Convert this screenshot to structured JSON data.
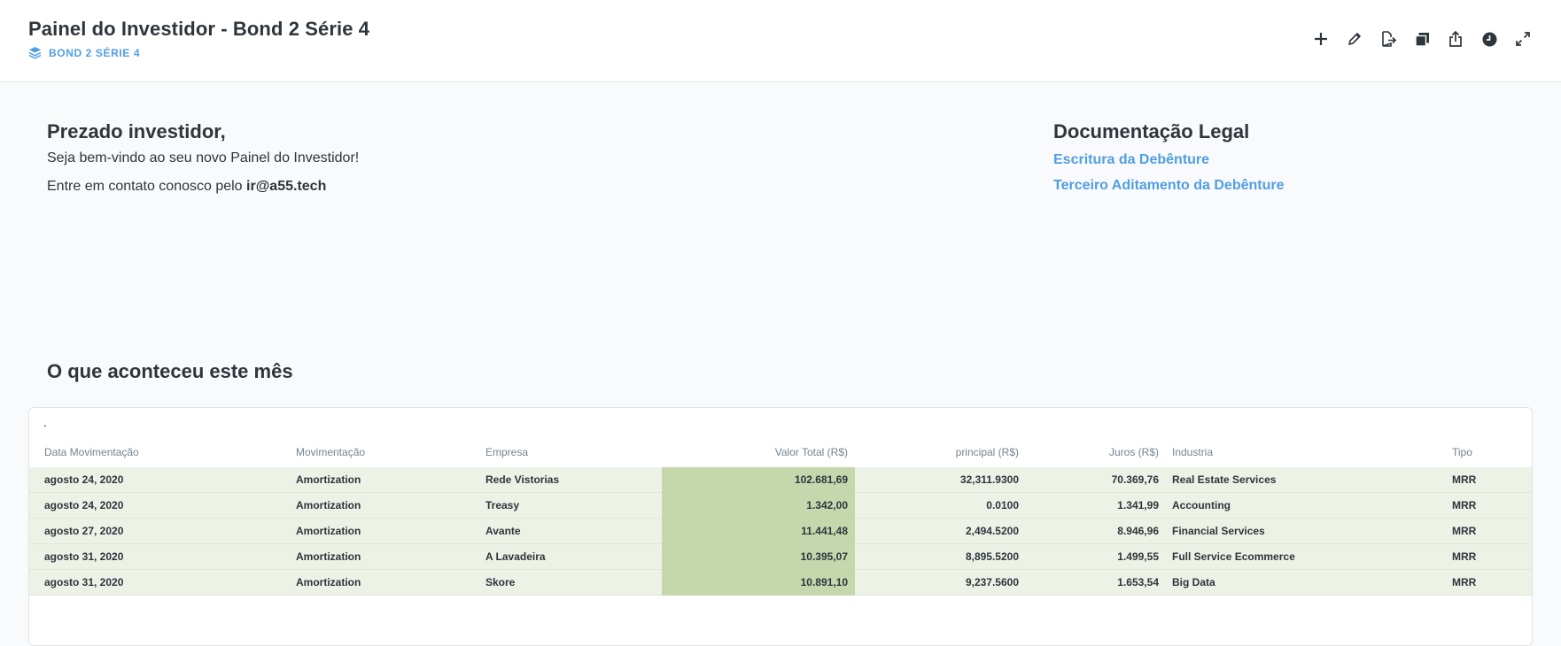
{
  "header": {
    "title": "Painel do Investidor - Bond 2 Série 4",
    "collection": "BOND 2 SÉRIE 4",
    "tools": [
      "add-icon",
      "pencil-icon",
      "move-icon",
      "duplicate-icon",
      "share-icon",
      "history-icon",
      "fullscreen-icon"
    ]
  },
  "welcome": {
    "heading": "Prezado investidor,",
    "line1": "Seja bem-vindo ao seu novo Painel do Investidor!",
    "line2_prefix": "Entre em contato conosco pelo",
    "email": "ir@a55.tech"
  },
  "legal": {
    "heading": "Documentação Legal",
    "link1": "Escritura da Debênture",
    "link2": "Terceiro Aditamento da Debênture"
  },
  "section": {
    "heading": "O que aconteceu este mês"
  },
  "table": {
    "title": ".",
    "columns": [
      "Data Movimentação",
      "Movimentação",
      "Empresa",
      "Valor Total (R$)",
      "principal (R$)",
      "Juros (R$)",
      "Industria",
      "Tipo"
    ],
    "rows": [
      [
        "agosto 24, 2020",
        "Amortization",
        "Rede Vistorias",
        "102.681,69",
        "32,311.9300",
        "70.369,76",
        "Real Estate Services",
        "MRR"
      ],
      [
        "agosto 24, 2020",
        "Amortization",
        "Treasy",
        "1.342,00",
        "0.0100",
        "1.341,99",
        "Accounting",
        "MRR"
      ],
      [
        "agosto 27, 2020",
        "Amortization",
        "Avante",
        "11.441,48",
        "2,494.5200",
        "8.946,96",
        "Financial Services",
        "MRR"
      ],
      [
        "agosto 31, 2020",
        "Amortization",
        "A Lavadeira",
        "10.395,07",
        "8,895.5200",
        "1.499,55",
        "Full Service Ecommerce",
        "MRR"
      ],
      [
        "agosto 31, 2020",
        "Amortization",
        "Skore",
        "10.891,10",
        "9,237.5600",
        "1.653,54",
        "Big Data",
        "MRR"
      ]
    ]
  },
  "colors": {
    "accent": "#509ee3",
    "row_bg": "#edf2e7",
    "highlight": "#c5d7ad"
  }
}
